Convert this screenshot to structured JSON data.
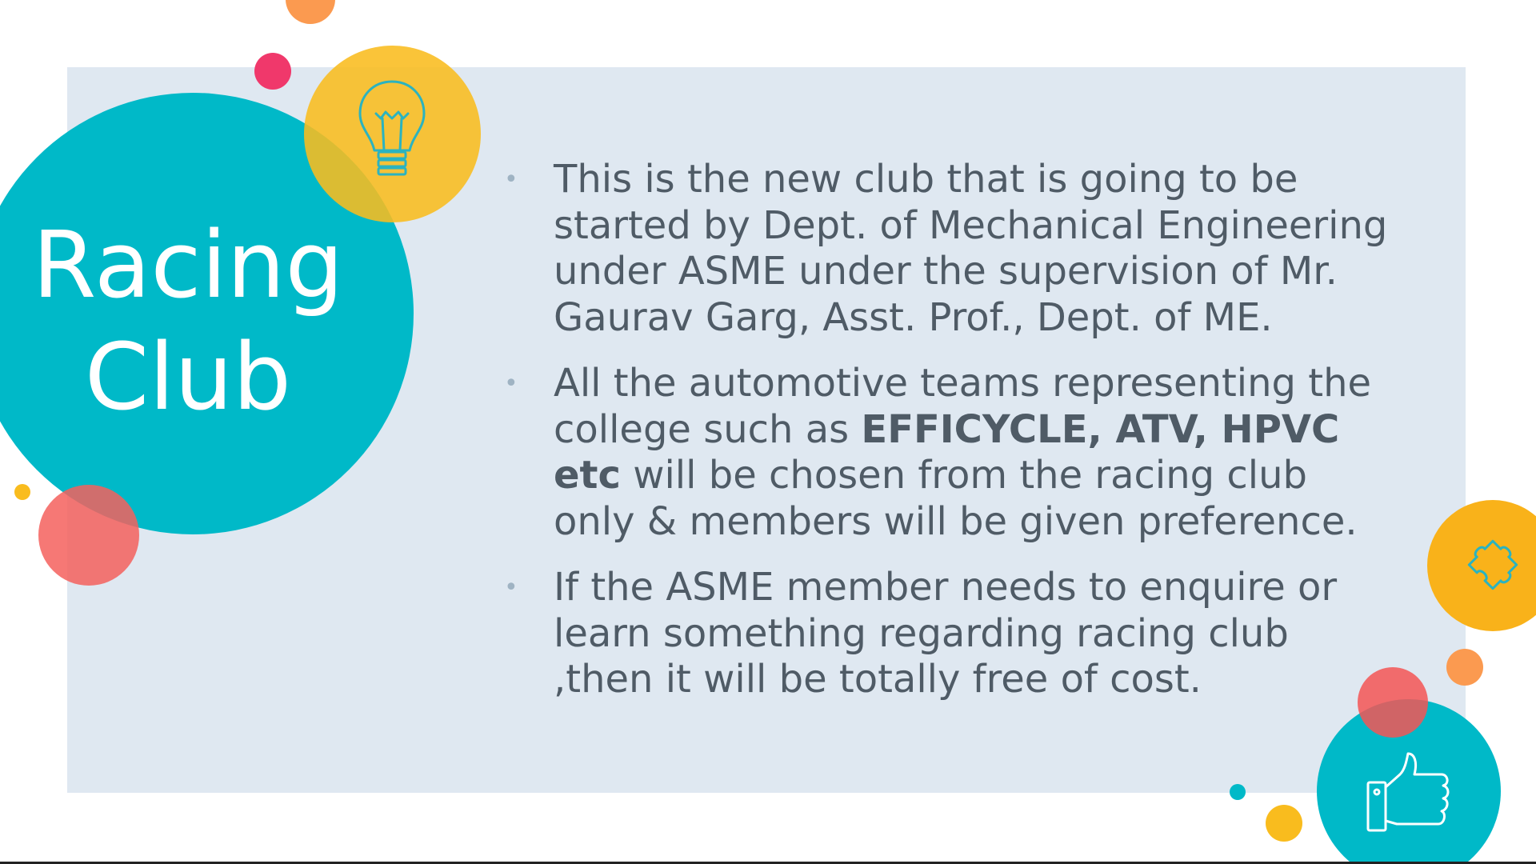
{
  "slide": {
    "title_line1": "Racing",
    "title_line2": "Club",
    "bullets": [
      {
        "text": "This is the new club that is going to be started by Dept. of Mechanical Engineering under ASME under the supervision of Mr. Gaurav Garg, Asst. Prof., Dept. of ME."
      },
      {
        "pre": "All the automotive teams representing the college such as ",
        "bold": "EFFICYCLE, ATV, HPVC etc",
        "post": " will be chosen  from the racing club only & members will be given preference."
      },
      {
        "text": "If the ASME member needs to enquire or learn something regarding racing club ,then it will be totally free of cost."
      }
    ]
  },
  "colors": {
    "panel": "#dfe8f1",
    "teal": "#00b9c8",
    "yellow": "#f9bc1e",
    "orange": "#fb9a50",
    "coral": "#f5605d",
    "pink": "#f0386b",
    "text": "#4f5b66"
  },
  "icons": [
    "lightbulb-icon",
    "puzzle-icon",
    "thumbs-up-icon"
  ]
}
